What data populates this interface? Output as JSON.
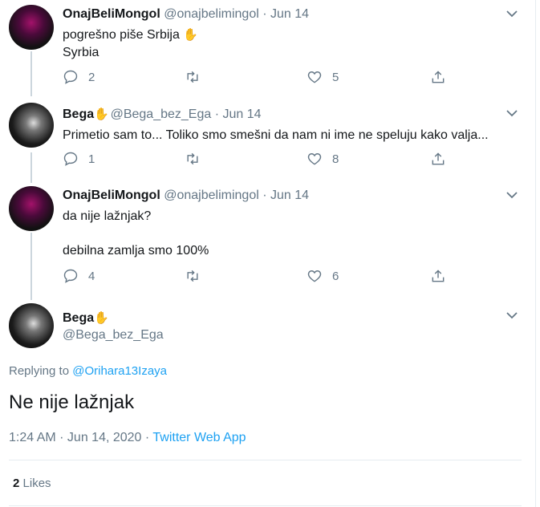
{
  "tweets": [
    {
      "name": "OnajBeliMongol",
      "handle": "@onajbelimingol",
      "date": "Jun 14",
      "lines": [
        "pogrešno piše Srbija",
        "Syrbia"
      ],
      "replies": "2",
      "retweets": "",
      "likes": "5"
    },
    {
      "name": "Bega",
      "handle": "@Bega_bez_Ega",
      "date": "Jun 14",
      "lines": [
        "Primetio sam to... Toliko smo smešni da nam ni ime ne speluju kako valja..."
      ],
      "replies": "1",
      "retweets": "",
      "likes": "8"
    },
    {
      "name": "OnajBeliMongol",
      "handle": "@onajbelimingol",
      "date": "Jun 14",
      "lines": [
        "da nije lažnjak?",
        "debilna zamlja smo 100%"
      ],
      "replies": "4",
      "retweets": "",
      "likes": "6"
    }
  ],
  "main": {
    "name": "Bega",
    "handle": "@Bega_bez_Ega",
    "replying_prefix": "Replying to",
    "replying_to": "@Orihara13Izaya",
    "text": "Ne nije lažnjak",
    "timestamp": "1:24 AM · Jun 14, 2020 ·",
    "source": "Twitter Web App",
    "likes_count": "2",
    "likes_label": "Likes"
  },
  "dot": "·",
  "icons": {
    "emoji": "middle-finger-emoji",
    "reply": "reply-icon",
    "retweet": "retweet-icon",
    "like": "heart-icon",
    "share": "share-icon",
    "caret": "chevron-down-icon"
  },
  "colors": {
    "link": "#1da1f2",
    "secondary": "#657786",
    "text": "#14171a",
    "line": "#ccd6dd"
  }
}
